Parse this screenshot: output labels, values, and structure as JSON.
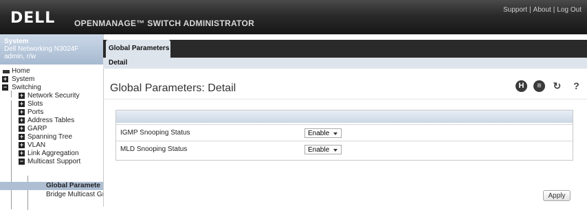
{
  "header": {
    "logo": "DELL",
    "app_title": "OPENMANAGE™ SWITCH ADMINISTRATOR",
    "links": [
      "Support",
      "About",
      "Log Out"
    ]
  },
  "system": {
    "title": "System",
    "device": "Dell Networking N3024F",
    "user": "admin, r/w"
  },
  "nav": {
    "home": "Home",
    "system": "System",
    "switching": "Switching",
    "network_security": "Network Security",
    "slots": "Slots",
    "ports": "Ports",
    "address_tables": "Address Tables",
    "garp": "GARP",
    "spanning_tree": "Spanning Tree",
    "vlan": "VLAN",
    "link_aggregation": "Link Aggregation",
    "multicast_support": "Multicast Support",
    "global_parameters": "Global Paramete",
    "bridge_multicast": "Bridge Multicast Gro"
  },
  "tabs": {
    "active": "Global Parameters",
    "sub": "Detail"
  },
  "page": {
    "title": "Global Parameters: Detail",
    "icons": [
      "save-icon",
      "print-icon",
      "refresh-icon",
      "help-icon"
    ]
  },
  "form": {
    "rows": [
      {
        "label": "IGMP Snooping Status",
        "value": "Enable"
      },
      {
        "label": "MLD Snooping Status",
        "value": "Enable"
      }
    ]
  },
  "apply_label": "Apply"
}
